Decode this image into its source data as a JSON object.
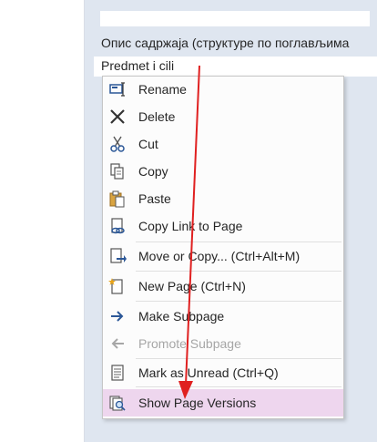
{
  "page_list": {
    "items": [
      "Опис садржаја (структуре по поглављима",
      "Predmet i cili",
      ""
    ]
  },
  "context_menu": {
    "items": [
      {
        "label": "Rename",
        "icon": "rename-icon"
      },
      {
        "label": "Delete",
        "icon": "delete-icon"
      },
      {
        "label": "Cut",
        "icon": "cut-icon"
      },
      {
        "label": "Copy",
        "icon": "copy-icon"
      },
      {
        "label": "Paste",
        "icon": "paste-icon"
      },
      {
        "label": "Copy Link to Page",
        "icon": "link-icon"
      },
      {
        "label": "Move or Copy...  (Ctrl+Alt+M)",
        "icon": "move-copy-icon"
      },
      {
        "label": "New Page  (Ctrl+N)",
        "icon": "new-page-icon"
      },
      {
        "label": "Make Subpage",
        "icon": "arrow-right-icon"
      },
      {
        "label": "Promote Subpage",
        "icon": "arrow-left-icon",
        "disabled": true
      },
      {
        "label": "Mark as Unread  (Ctrl+Q)",
        "icon": "mark-unread-icon"
      },
      {
        "label": "Show Page Versions",
        "icon": "page-versions-icon",
        "highlighted": true
      }
    ]
  },
  "annotation": {
    "color": "#e02020"
  },
  "colors": {
    "panel": "#dfe6f0",
    "highlight": "#eed6ee",
    "icon_blue": "#2b5797"
  }
}
